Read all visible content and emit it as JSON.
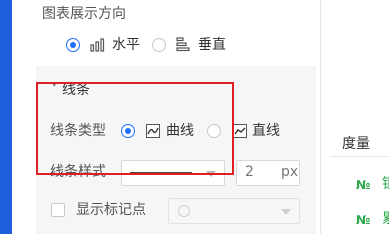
{
  "direction": {
    "title": "图表展示方向",
    "options": [
      {
        "label": "水平",
        "selected": true,
        "icon": "bar-chart-horizontal-icon"
      },
      {
        "label": "垂直",
        "selected": false,
        "icon": "bar-chart-vertical-icon"
      }
    ]
  },
  "line_group": {
    "header": "线条",
    "line_type": {
      "label": "线条类型",
      "options": [
        {
          "label": "曲线",
          "selected": true,
          "icon": "curve-line-icon"
        },
        {
          "label": "直线",
          "selected": false,
          "icon": "straight-line-icon"
        }
      ]
    },
    "line_style": {
      "label": "线条样式",
      "width_value": "2",
      "width_unit": "px"
    },
    "show_markers": {
      "label": "显示标记点",
      "checked": false
    }
  },
  "right_panel": {
    "header": "度量",
    "rows": [
      {
        "badge": "№",
        "text": "银"
      },
      {
        "badge": "№",
        "text": "累"
      }
    ]
  },
  "colors": {
    "accent": "#1f6fff",
    "highlight": "#e02020",
    "measure_green": "#2ba84a",
    "sidebar_blue": "#1f5fdc"
  }
}
